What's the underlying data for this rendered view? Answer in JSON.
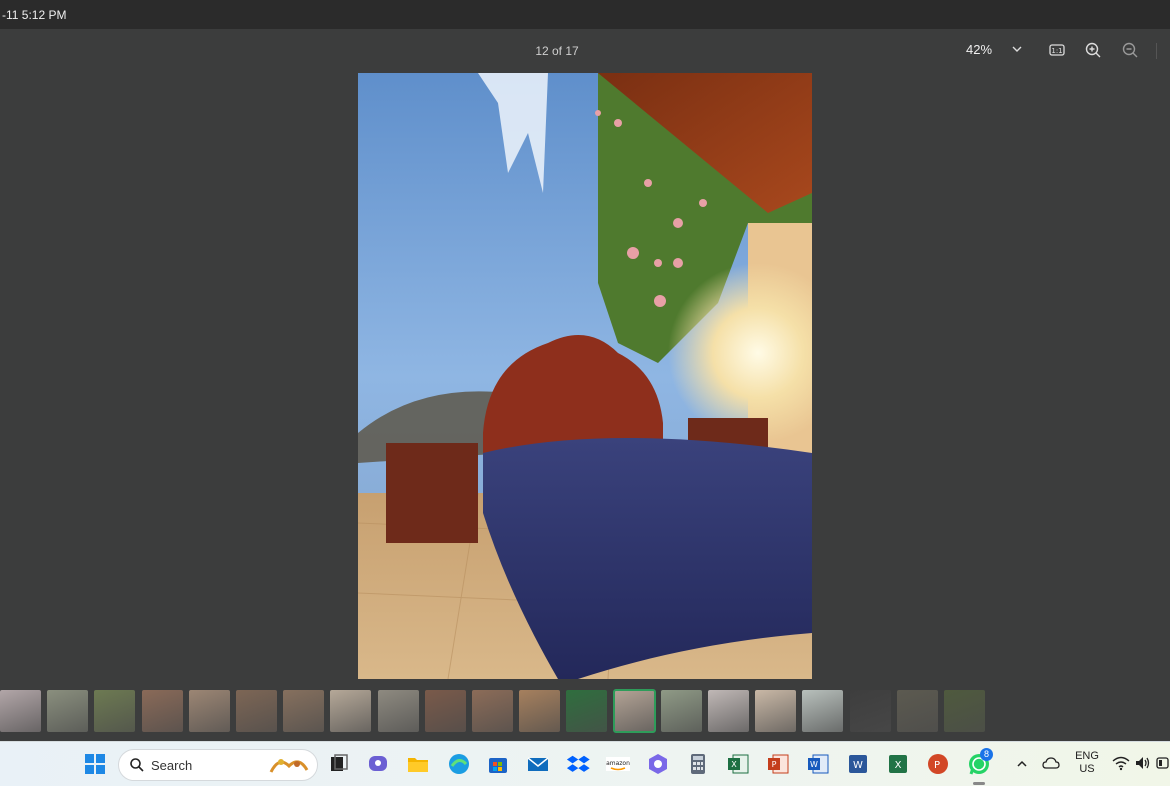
{
  "statusbar": {
    "time": "-11 5:12 PM"
  },
  "viewer": {
    "counter": "12 of 17",
    "zoom": "42%"
  },
  "filmstrip": {
    "selected_index": 13,
    "thumb_colors": [
      "#b2a6a8",
      "#8a8f7e",
      "#6d7a52",
      "#8a6a58",
      "#9c8674",
      "#7d6655",
      "#86705e",
      "#b5a898",
      "#8e8a80",
      "#7a5a4a",
      "#8c6c58",
      "#a6805e",
      "#2f6e3e",
      "#b4a496",
      "#8f9a86",
      "#c0b8b6",
      "#c9b8a6",
      "#b8c0bc",
      "#3e3e3e",
      "#5c5a50",
      "#4f5a3e"
    ]
  },
  "taskbar": {
    "search_label": "Search",
    "lang_line1": "ENG",
    "lang_line2": "US",
    "whatsapp_badge": "8"
  }
}
